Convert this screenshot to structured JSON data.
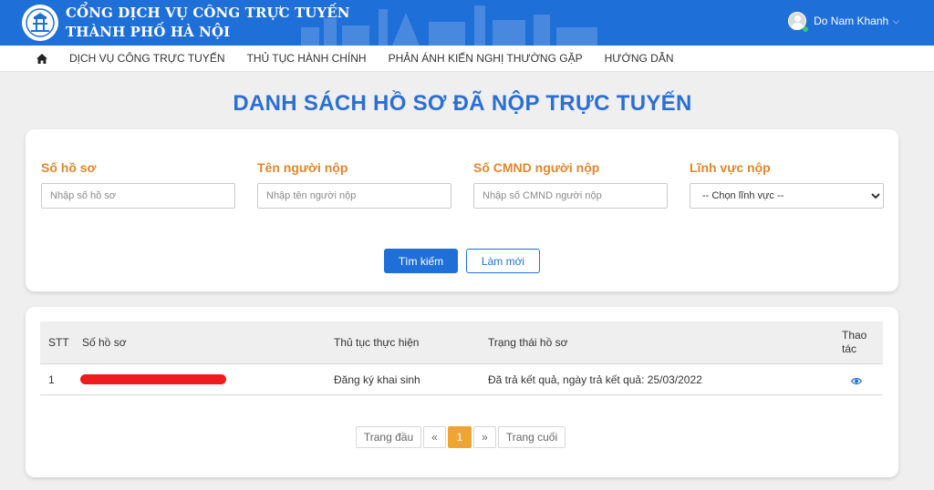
{
  "header": {
    "title_line1": "CỔNG DỊCH VỤ CÔNG TRỰC TUYẾN",
    "title_line2": "THÀNH PHỐ HÀ NỘI",
    "user_name": "Do Nam Khanh",
    "brand_color": "#1f6fd8"
  },
  "nav": {
    "items": [
      {
        "label": "DỊCH VỤ CÔNG TRỰC TUYẾN"
      },
      {
        "label": "THỦ TỤC HÀNH CHÍNH"
      },
      {
        "label": "PHẢN ÁNH KIẾN NGHỊ THƯỜNG GẶP"
      },
      {
        "label": "HƯỚNG DẪN"
      }
    ]
  },
  "page": {
    "title": "DANH SÁCH HỒ SƠ ĐÃ NỘP TRỰC TUYẾN"
  },
  "search": {
    "fields": [
      {
        "label": "Số hồ sơ",
        "placeholder": "Nhập số hồ sơ"
      },
      {
        "label": "Tên người nộp",
        "placeholder": "Nhập tên người nộp"
      },
      {
        "label": "Số CMND người nộp",
        "placeholder": "Nhập số CMND người nộp"
      },
      {
        "label": "Lĩnh vực nộp",
        "selected": "-- Chọn lĩnh vực --"
      }
    ],
    "search_button": "Tìm kiếm",
    "reset_button": "Làm mới",
    "label_color": "#e0862b"
  },
  "table": {
    "headers": {
      "stt": "STT",
      "so_ho_so": "Số hồ sơ",
      "thu_tuc": "Thủ tục thực hiện",
      "trang_thai": "Trạng thái hồ sơ",
      "thao_tac_1": "Thao",
      "thao_tac_2": "tác"
    },
    "rows": [
      {
        "stt": "1",
        "so_ho_so": "",
        "thu_tuc": "Đăng ký khai sinh",
        "trang_thai": "Đã trả kết quả, ngày trả kết quả: 25/03/2022",
        "action_icon": "eye-icon"
      }
    ]
  },
  "pagination": {
    "first": "Trang đầu",
    "prev": "«",
    "current": "1",
    "next": "»",
    "last": "Trang cuối",
    "active_color": "#f0a533"
  }
}
